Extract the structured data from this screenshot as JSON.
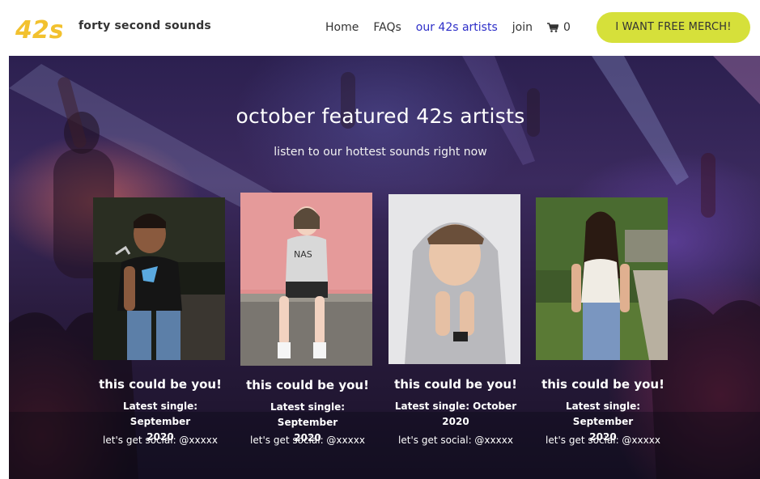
{
  "header": {
    "brand": "forty second sounds",
    "logo_text": "42s",
    "nav": [
      {
        "label": "Home",
        "active": false
      },
      {
        "label": "FAQs",
        "active": false
      },
      {
        "label": "our 42s artists",
        "active": true
      },
      {
        "label": "join",
        "active": false
      }
    ],
    "cart_count": "0",
    "merch_button": "I WANT FREE MERCH!"
  },
  "hero": {
    "title": "october featured 42s artists",
    "subtitle": "listen to our hottest sounds right now"
  },
  "artists": [
    {
      "title": "this could be you!",
      "single_line1": "Latest single: September",
      "single_line2": "2020",
      "social": "let's get social: @xxxxx"
    },
    {
      "title": "this could be you!",
      "single_line1": "Latest single: September",
      "single_line2": "2020",
      "social": "let's get social: @xxxxx"
    },
    {
      "title": "this could be you!",
      "single_line1": "Latest single: October",
      "single_line2": "2020",
      "social": "let's get social: @xxxxx"
    },
    {
      "title": "this could be you!",
      "single_line1": "Latest single: September",
      "single_line2": "2020",
      "social": "let's get social: @xxxxx"
    }
  ],
  "colors": {
    "accent_button": "#d6e03a",
    "active_nav": "#2d2ec8",
    "logo_yellow": "#f2c12e"
  },
  "icons": {
    "cart": "shopping-cart-icon"
  }
}
